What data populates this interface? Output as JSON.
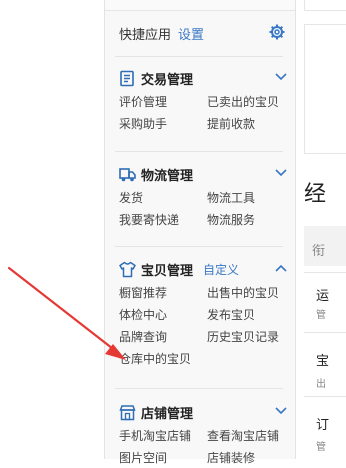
{
  "quick_apps": {
    "title": "快捷应用",
    "settings_link": "设置"
  },
  "sections": {
    "trade": {
      "title": "交易管理",
      "items": [
        "评价管理",
        "已卖出的宝贝",
        "采购助手",
        "提前收款"
      ]
    },
    "logistics": {
      "title": "物流管理",
      "items": [
        "发货",
        "物流工具",
        "我要寄快递",
        "物流服务"
      ]
    },
    "goods": {
      "title": "宝贝管理",
      "customize": "自定义",
      "items": [
        "橱窗推荐",
        "出售中的宝贝",
        "体检中心",
        "发布宝贝",
        "品牌查询",
        "历史宝贝记录",
        "仓库中的宝贝"
      ]
    },
    "shop": {
      "title": "店铺管理",
      "items": [
        "手机淘宝店铺",
        "查看淘宝店铺",
        "图片空间",
        "店铺装修"
      ]
    }
  },
  "right_panel": {
    "heading_char": "经",
    "chars": [
      "衔",
      "运",
      "管",
      "宝",
      "出",
      "订",
      "管"
    ]
  },
  "colors": {
    "accent": "#3a78c5",
    "arrow": "#e53935"
  },
  "icons": [
    "gear-icon",
    "trade-icon",
    "truck-icon",
    "shirt-icon",
    "shop-icon",
    "chevron-down-icon",
    "chevron-up-icon"
  ]
}
